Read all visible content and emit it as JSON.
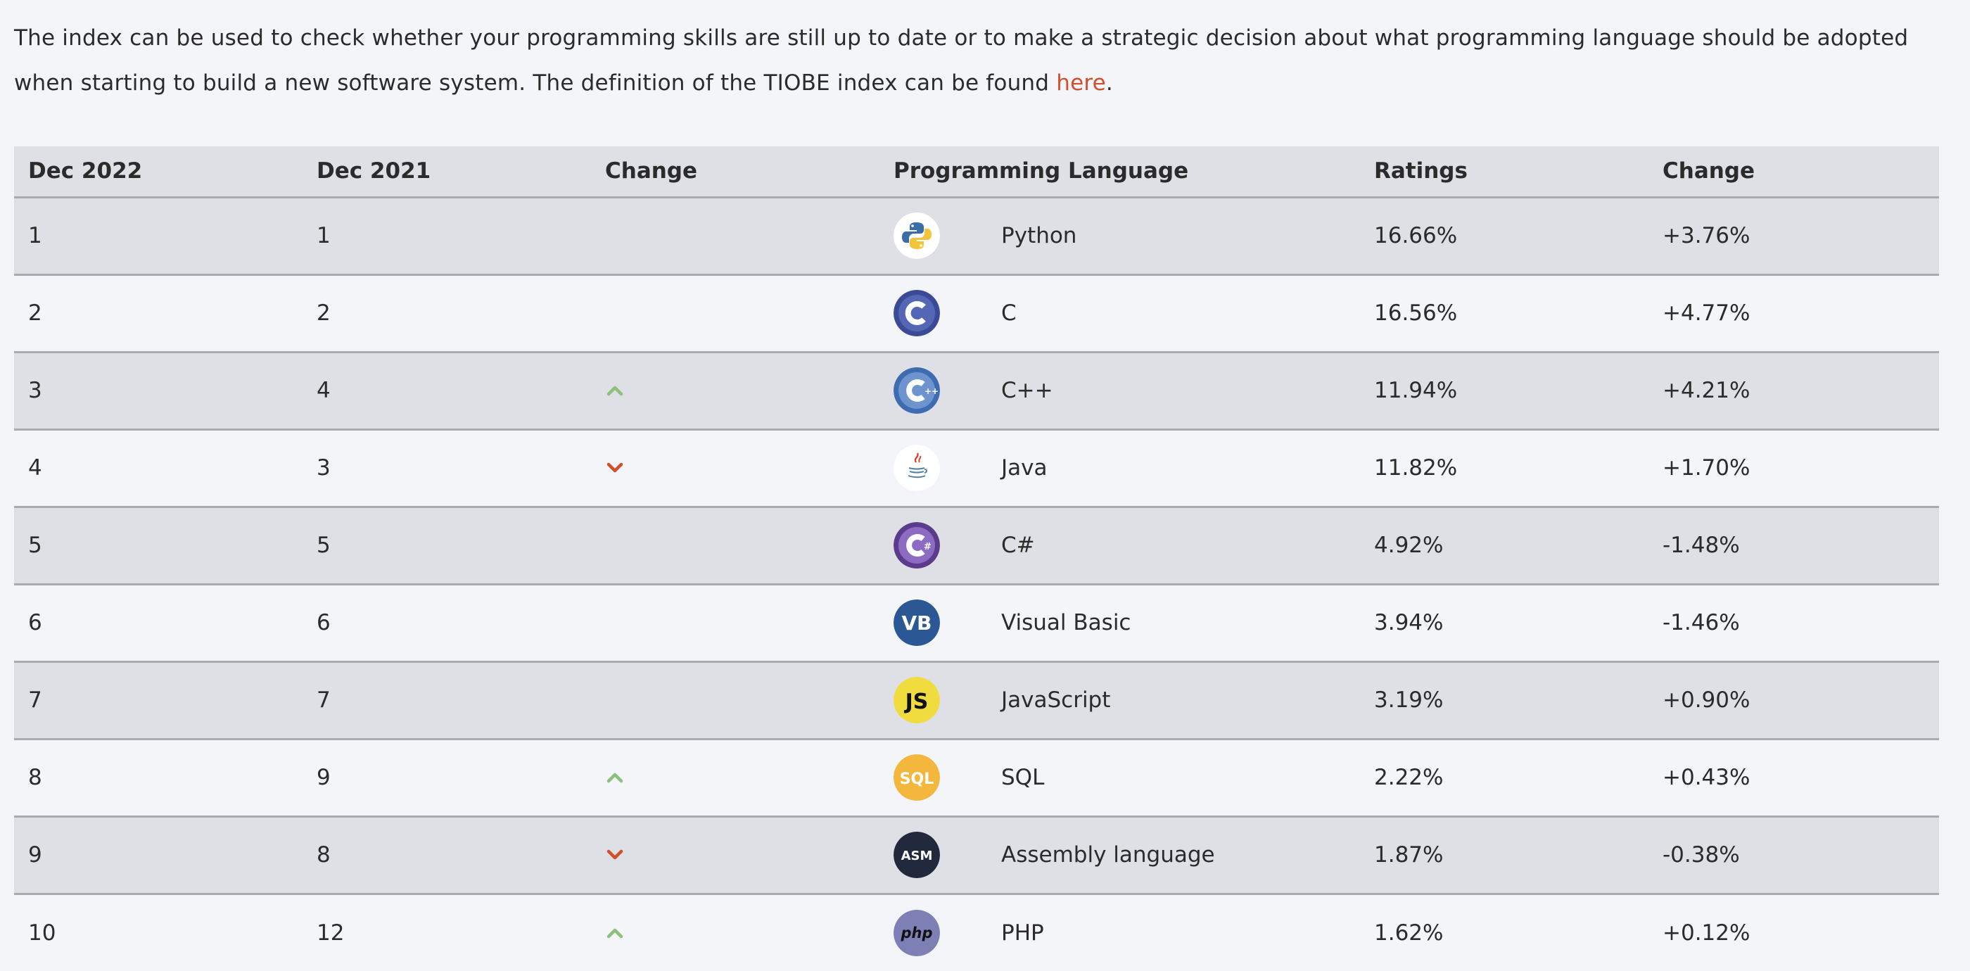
{
  "intro": {
    "text_before_link": "The index can be used to check whether your programming skills are still up to date or to make a strategic decision about what programming language should be adopted when starting to build a new software system. The definition of the TIOBE index can be found ",
    "link_text": "here",
    "text_after_link": "."
  },
  "table": {
    "headers": [
      "Dec 2022",
      "Dec 2021",
      "Change",
      "Programming Language",
      "Ratings",
      "Change"
    ],
    "rows": [
      {
        "rank_2022": "1",
        "rank_2021": "1",
        "trend": "none",
        "logo": "python-icon",
        "language": "Python",
        "rating": "16.66%",
        "change": "+3.76%"
      },
      {
        "rank_2022": "2",
        "rank_2021": "2",
        "trend": "none",
        "logo": "c-icon",
        "language": "C",
        "rating": "16.56%",
        "change": "+4.77%"
      },
      {
        "rank_2022": "3",
        "rank_2021": "4",
        "trend": "up",
        "logo": "cpp-icon",
        "language": "C++",
        "rating": "11.94%",
        "change": "+4.21%"
      },
      {
        "rank_2022": "4",
        "rank_2021": "3",
        "trend": "down",
        "logo": "java-icon",
        "language": "Java",
        "rating": "11.82%",
        "change": "+1.70%"
      },
      {
        "rank_2022": "5",
        "rank_2021": "5",
        "trend": "none",
        "logo": "csharp-icon",
        "language": "C#",
        "rating": "4.92%",
        "change": "-1.48%"
      },
      {
        "rank_2022": "6",
        "rank_2021": "6",
        "trend": "none",
        "logo": "visual-basic-icon",
        "language": "Visual Basic",
        "rating": "3.94%",
        "change": "-1.46%"
      },
      {
        "rank_2022": "7",
        "rank_2021": "7",
        "trend": "none",
        "logo": "javascript-icon",
        "language": "JavaScript",
        "rating": "3.19%",
        "change": "+0.90%"
      },
      {
        "rank_2022": "8",
        "rank_2021": "9",
        "trend": "up",
        "logo": "sql-icon",
        "language": "SQL",
        "rating": "2.22%",
        "change": "+0.43%"
      },
      {
        "rank_2022": "9",
        "rank_2021": "8",
        "trend": "down",
        "logo": "assembly-icon",
        "language": "Assembly language",
        "rating": "1.87%",
        "change": "-0.38%"
      },
      {
        "rank_2022": "10",
        "rank_2021": "12",
        "trend": "up",
        "logo": "php-icon",
        "language": "PHP",
        "rating": "1.62%",
        "change": "+0.12%"
      }
    ]
  },
  "colors": {
    "link": "#d0502e",
    "trend_up": "#8bc17b",
    "trend_down": "#d0502e",
    "row_shade": "#dee0e5",
    "page_background": "#f3f5f9"
  }
}
